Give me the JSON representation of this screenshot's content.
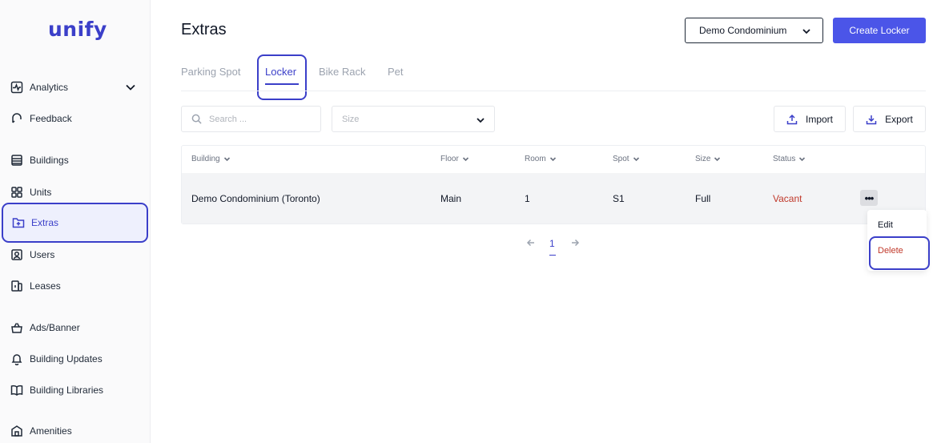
{
  "brand": {
    "logo": "unify",
    "accent": "#3b3fc9"
  },
  "sidebar": {
    "items": [
      {
        "label": "Analytics",
        "icon": "analytics-icon"
      },
      {
        "label": "Feedback",
        "icon": "feedback-icon"
      },
      {
        "label": "Buildings",
        "icon": "buildings-icon"
      },
      {
        "label": "Units",
        "icon": "units-icon"
      },
      {
        "label": "Extras",
        "icon": "extras-icon",
        "active": true
      },
      {
        "label": "Users",
        "icon": "users-icon"
      },
      {
        "label": "Leases",
        "icon": "leases-icon"
      },
      {
        "label": "Ads/Banner",
        "icon": "ads-icon"
      },
      {
        "label": "Building Updates",
        "icon": "bell-icon"
      },
      {
        "label": "Building Libraries",
        "icon": "book-icon"
      },
      {
        "label": "Amenities",
        "icon": "amenities-icon"
      }
    ]
  },
  "header": {
    "title": "Extras",
    "building_select": "Demo Condominium",
    "create_label": "Create Locker"
  },
  "tabs": [
    "Parking Spot",
    "Locker",
    "Bike Rack",
    "Pet"
  ],
  "active_tab": "Locker",
  "filters": {
    "search_placeholder": "Search ...",
    "size_placeholder": "Size",
    "import_label": "Import",
    "export_label": "Export"
  },
  "table": {
    "columns": [
      "Building",
      "Floor",
      "Room",
      "Spot",
      "Size",
      "Status"
    ],
    "rows": [
      {
        "building": "Demo Condominium (Toronto)",
        "floor": "Main",
        "room": "1",
        "spot": "S1",
        "size": "Full",
        "status": "Vacant"
      }
    ]
  },
  "row_menu": {
    "edit": "Edit",
    "delete": "Delete"
  },
  "pagination": {
    "current": "1"
  }
}
